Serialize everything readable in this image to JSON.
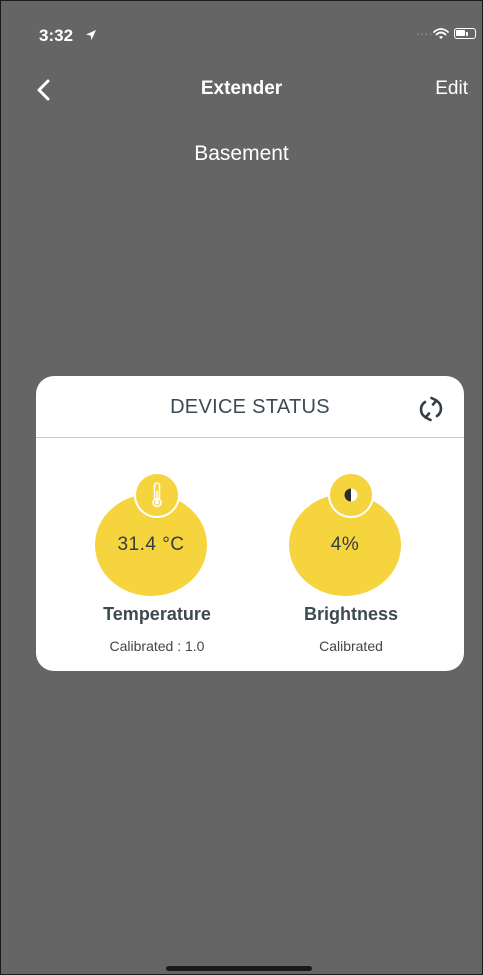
{
  "status_bar": {
    "time": "3:32",
    "signal_dots": "....",
    "icons": [
      "location-arrow-icon",
      "wifi-icon",
      "battery-icon"
    ]
  },
  "nav": {
    "title": "Extender",
    "edit_label": "Edit",
    "back_icon": "chevron-left-icon"
  },
  "location": "Basement",
  "device_status": {
    "title": "DEVICE STATUS",
    "refresh_icon": "refresh-icon",
    "sensors": [
      {
        "value": "31.4 °C",
        "label": "Temperature",
        "note": "Calibrated : 1.0",
        "icon": "thermometer-icon"
      },
      {
        "value": "4%",
        "label": "Brightness",
        "note": "Calibrated",
        "icon": "brightness-icon"
      }
    ]
  },
  "colors": {
    "background": "#656565",
    "card": "#ffffff",
    "accent_yellow": "#f5d43d",
    "text_dark": "#3d4a52"
  }
}
